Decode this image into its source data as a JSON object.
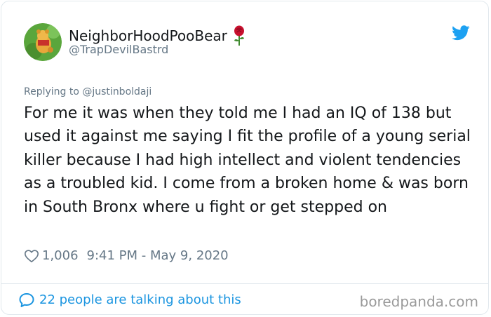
{
  "tweet": {
    "display_name": "NeighborHoodPooBear",
    "display_name_emoji": "rose-icon",
    "handle": "@TrapDevilBastrd",
    "replying_to": "Replying to @justinboldaji",
    "text": "For me it was when they told me I had an IQ of 138 but used it against me saying I fit the profile of a young serial killer because I had high intellect and violent tendencies as a troubled kid. I come from a broken home & was born in South Bronx where u fight or get stepped on",
    "likes": "1,006",
    "timestamp": "9:41 PM - May 9, 2020",
    "talking": "22 people are talking about this"
  },
  "watermark": "boredpanda.com",
  "colors": {
    "accent": "#1b95e0",
    "twitter_blue": "#1da1f2",
    "muted": "#657786",
    "border": "#e1e8ed"
  },
  "icons": {
    "bird": "twitter-bird-icon",
    "heart": "heart-outline-icon",
    "bubble": "comment-bubble-icon",
    "avatar": "winnie-the-pooh-avatar"
  }
}
